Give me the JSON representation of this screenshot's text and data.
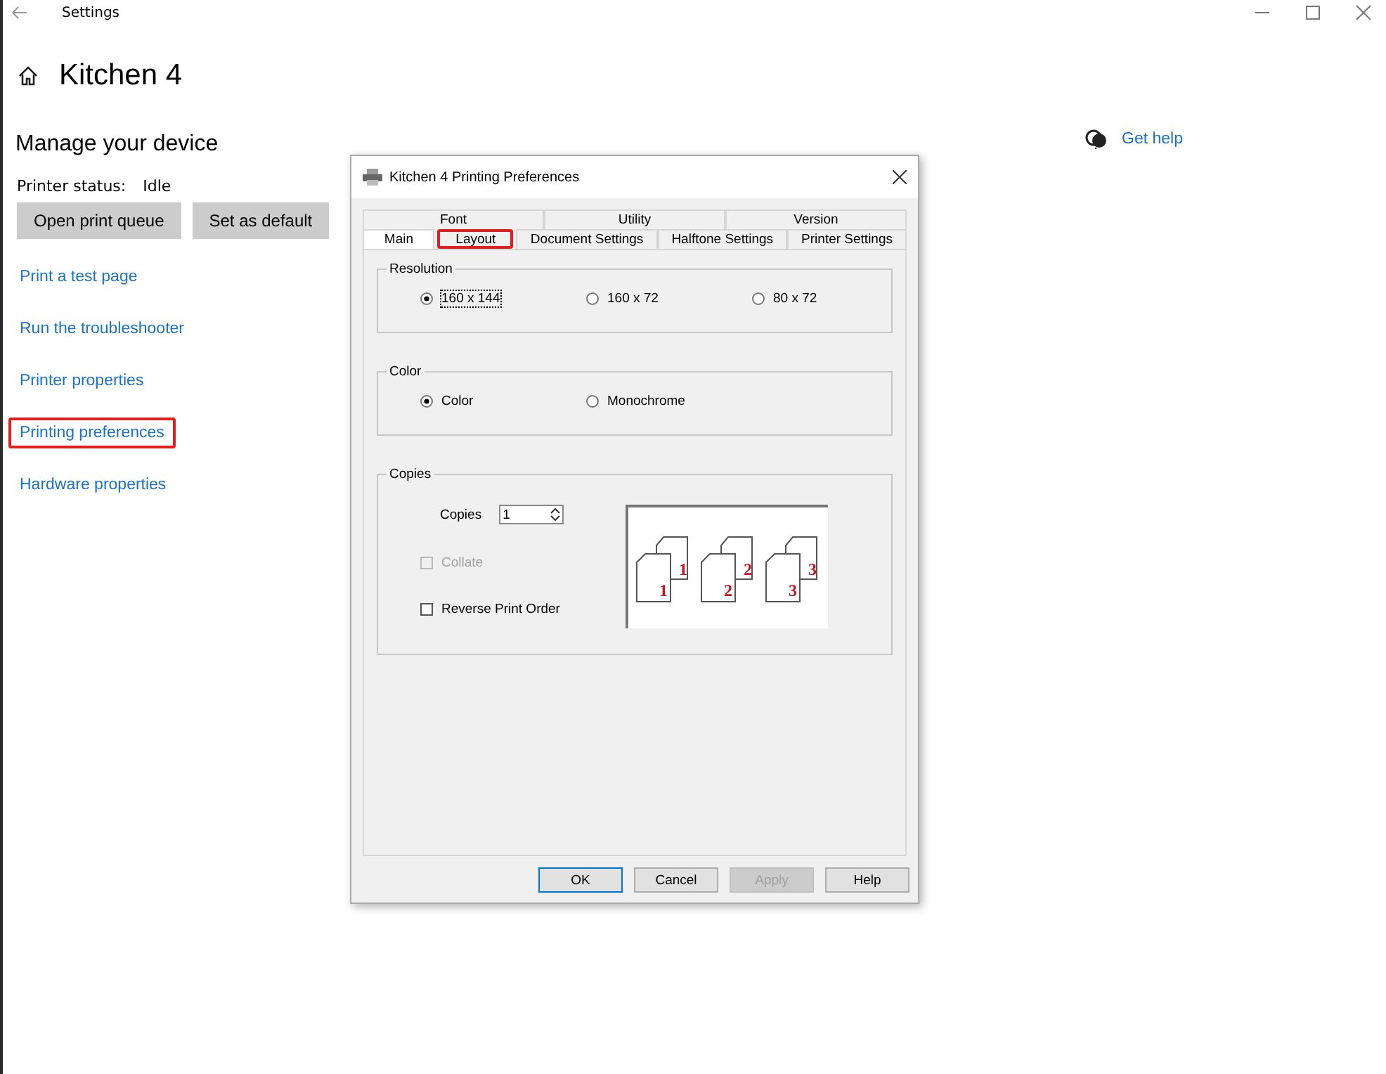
{
  "window": {
    "title": "Settings"
  },
  "page": {
    "title": "Kitchen 4",
    "section": "Manage your device",
    "status_label": "Printer status:",
    "status_value": "Idle"
  },
  "buttons": [
    "Open print queue",
    "Set as default"
  ],
  "links": [
    {
      "label": "Print a test page",
      "highlighted": false
    },
    {
      "label": "Run the troubleshooter",
      "highlighted": false
    },
    {
      "label": "Printer properties",
      "highlighted": false
    },
    {
      "label": "Printing preferences",
      "highlighted": true
    },
    {
      "label": "Hardware properties",
      "highlighted": false
    }
  ],
  "help": {
    "label": "Get help"
  },
  "dialog": {
    "title": "Kitchen 4 Printing Preferences",
    "tab_rows": [
      [
        {
          "label": "Font",
          "selected": false,
          "highlighted": false
        },
        {
          "label": "Utility",
          "selected": false,
          "highlighted": false
        },
        {
          "label": "Version",
          "selected": false,
          "highlighted": false
        }
      ],
      [
        {
          "label": "Main",
          "selected": true,
          "highlighted": false
        },
        {
          "label": "Layout",
          "selected": false,
          "highlighted": true
        },
        {
          "label": "Document Settings",
          "selected": false,
          "highlighted": false
        },
        {
          "label": "Halftone Settings",
          "selected": false,
          "highlighted": false
        },
        {
          "label": "Printer Settings",
          "selected": false,
          "highlighted": false
        }
      ]
    ],
    "resolution": {
      "title": "Resolution",
      "options": [
        {
          "label": "160 x 144",
          "selected": true
        },
        {
          "label": "160 x 72",
          "selected": false
        },
        {
          "label": "80 x 72",
          "selected": false
        }
      ]
    },
    "color": {
      "title": "Color",
      "options": [
        {
          "label": "Color",
          "selected": true
        },
        {
          "label": "Monochrome",
          "selected": false
        }
      ]
    },
    "copies": {
      "title": "Copies",
      "label": "Copies",
      "value": "1",
      "checkboxes": [
        {
          "label": "Collate",
          "checked": false,
          "disabled": true
        },
        {
          "label": "Reverse Print Order",
          "checked": false,
          "disabled": false
        }
      ],
      "illustration_labels": [
        [
          "1",
          "1"
        ],
        [
          "2",
          "2"
        ],
        [
          "3",
          "3"
        ]
      ]
    },
    "buttons": [
      {
        "label": "OK",
        "kind": "default",
        "disabled": false
      },
      {
        "label": "Cancel",
        "kind": "normal",
        "disabled": false
      },
      {
        "label": "Apply",
        "kind": "normal",
        "disabled": true
      },
      {
        "label": "Help",
        "kind": "normal",
        "disabled": false
      }
    ]
  }
}
